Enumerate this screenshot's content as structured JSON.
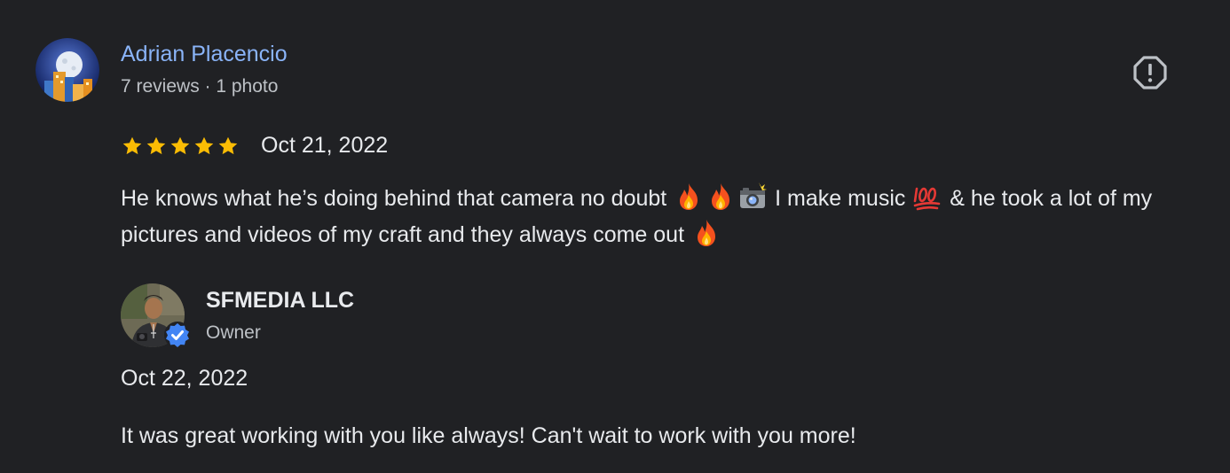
{
  "review": {
    "reviewer_name": "Adrian Placencio",
    "reviewer_meta": "7 reviews · 1 photo",
    "rating": 5,
    "rating_max": 5,
    "date": "Oct 21, 2022",
    "text_segments": [
      "He knows what he’s doing behind that camera no doubt ",
      " I make music ",
      " & he took a lot of my pictures and videos of my craft and they always come out "
    ],
    "icons": [
      "fire-icon",
      "fire-icon",
      "camera-flash-icon",
      "hundred-points-icon",
      "fire-icon"
    ],
    "star_color": "#fbbc04"
  },
  "reply": {
    "owner_name": "SFMEDIA LLC",
    "owner_role": "Owner",
    "date": "Oct 22, 2022",
    "text": "It was great working with you like always! Can't wait to work with you more!",
    "badge_color": "#4285f4"
  },
  "actions": {
    "report_icon": "report-icon"
  },
  "colors": {
    "background": "#202124",
    "link": "#8ab4f8",
    "text_primary": "#e8eaed",
    "text_secondary": "#bdc1c6"
  }
}
